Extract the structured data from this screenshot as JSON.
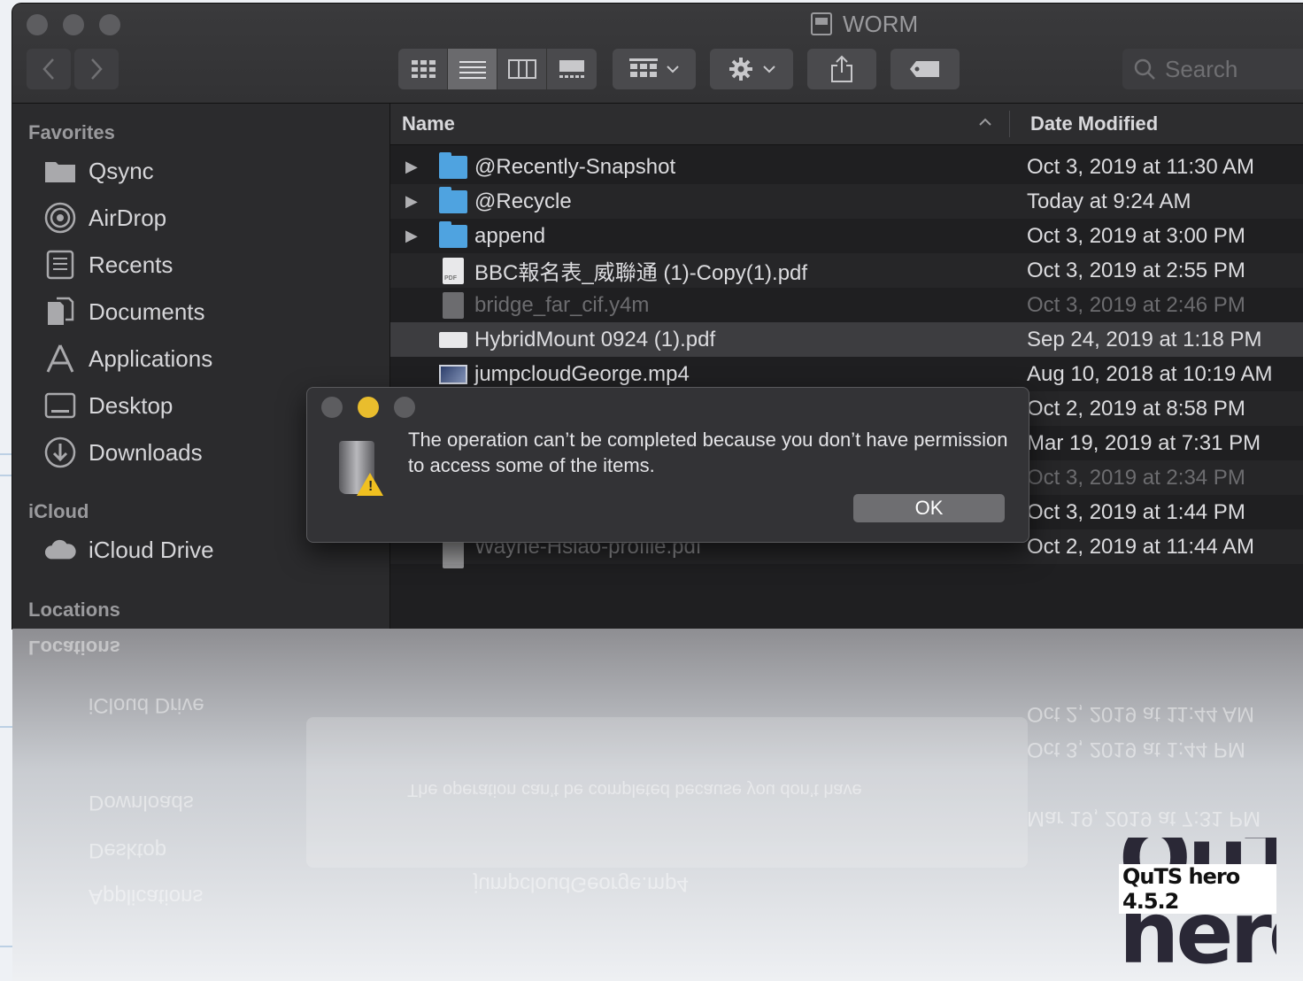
{
  "window": {
    "title": "WORM",
    "traffic_lights": [
      "close",
      "minimize",
      "zoom"
    ]
  },
  "toolbar": {
    "back_icon": "chevron-left-icon",
    "forward_icon": "chevron-right-icon",
    "view_modes": [
      "icon-view",
      "list-view",
      "column-view",
      "gallery-view"
    ],
    "active_view": "list-view",
    "group_icon": "group-icon",
    "action_icon": "gear-icon",
    "share_icon": "share-icon",
    "tag_icon": "tag-icon",
    "search_placeholder": "Search"
  },
  "sidebar": {
    "favorites_label": "Favorites",
    "favorites": [
      {
        "label": "Qsync",
        "icon": "folder-icon"
      },
      {
        "label": "AirDrop",
        "icon": "airdrop-icon"
      },
      {
        "label": "Recents",
        "icon": "recents-icon"
      },
      {
        "label": "Documents",
        "icon": "documents-icon"
      },
      {
        "label": "Applications",
        "icon": "applications-icon"
      },
      {
        "label": "Desktop",
        "icon": "desktop-icon"
      },
      {
        "label": "Downloads",
        "icon": "downloads-icon"
      }
    ],
    "icloud_label": "iCloud",
    "icloud": [
      {
        "label": "iCloud Drive",
        "icon": "cloud-icon"
      }
    ],
    "locations_label": "Locations"
  },
  "file_list": {
    "col_name": "Name",
    "col_date": "Date Modified",
    "sort_icon": "chevron-up-icon",
    "rows": [
      {
        "name": "@Recently-Snapshot",
        "date": "Oct 3, 2019 at 11:30 AM",
        "type": "folder"
      },
      {
        "name": "@Recycle",
        "date": "Today at 9:24 AM",
        "type": "folder"
      },
      {
        "name": "append",
        "date": "Oct 3, 2019 at 3:00 PM",
        "type": "folder"
      },
      {
        "name": "BBC報名表_威聯通 (1)-Copy(1).pdf",
        "date": "Oct 3, 2019 at 2:55 PM",
        "type": "pdf"
      },
      {
        "name": "bridge_far_cif.y4m",
        "date": "Oct 3, 2019 at 2:46 PM",
        "type": "file-dim"
      },
      {
        "name": "HybridMount 0924 (1).pdf",
        "date": "Sep 24, 2019 at 1:18 PM",
        "type": "pdf-wide",
        "selected": true
      },
      {
        "name": "jumpcloudGeorge.mp4",
        "date": "Aug 10, 2018 at 10:19 AM",
        "type": "video"
      },
      {
        "name": "",
        "date": "Oct 2, 2019 at 8:58 PM",
        "type": "hidden"
      },
      {
        "name": "",
        "date": "Mar 19, 2019 at 7:31 PM",
        "type": "hidden"
      },
      {
        "name": "",
        "date": "Oct 3, 2019 at 2:34 PM",
        "type": "hidden-dim"
      },
      {
        "name": "",
        "date": "Oct 3, 2019 at 1:44 PM",
        "type": "hidden"
      },
      {
        "name": "Wayne-Hsiao-profile.pdf",
        "date": "Oct 2, 2019 at 11:44 AM",
        "type": "partial"
      }
    ]
  },
  "dialog": {
    "message": "The operation can’t be completed because you don’t have permission to access some of the items.",
    "ok_label": "OK",
    "icon": "trash-warning-icon"
  },
  "branding": {
    "big_text": "QuTS hero",
    "version_label": "QuTS hero 4.5.2"
  }
}
